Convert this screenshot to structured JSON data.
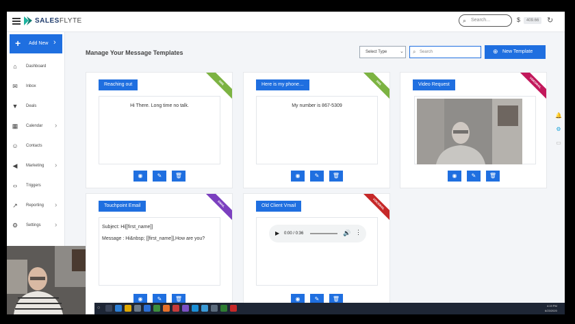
{
  "app": {
    "brand_part1": "SALES",
    "brand_part2": "FLYTE",
    "search_placeholder": "Search...",
    "currency": "$",
    "balance": "409.66"
  },
  "sidebar": {
    "add_new": "Add New",
    "items": [
      {
        "label": "Dashboard",
        "icon": "home-icon",
        "glyph": "⌂",
        "chevron": ""
      },
      {
        "label": "Inbox",
        "icon": "chat-icon",
        "glyph": "✉",
        "chevron": ""
      },
      {
        "label": "Deals",
        "icon": "filter-icon",
        "glyph": "▼",
        "chevron": ""
      },
      {
        "label": "Calendar",
        "icon": "calendar-icon",
        "glyph": "▦",
        "chevron": "›"
      },
      {
        "label": "Contacts",
        "icon": "users-icon",
        "glyph": "☺",
        "chevron": ""
      },
      {
        "label": "Marketing",
        "icon": "megaphone-icon",
        "glyph": "◀",
        "chevron": "›"
      },
      {
        "label": "Triggers",
        "icon": "code-icon",
        "glyph": "‹›",
        "chevron": ""
      },
      {
        "label": "Reporting",
        "icon": "chart-icon",
        "glyph": "↗",
        "chevron": "›"
      },
      {
        "label": "Settings",
        "icon": "gears-icon",
        "glyph": "⚙",
        "chevron": "›"
      }
    ]
  },
  "main": {
    "title": "Manage Your Message Templates",
    "select_type": "Select Type",
    "search_placeholder": "Search",
    "new_template": "New Template"
  },
  "templates": [
    {
      "title": "Reaching out",
      "type": "SMS",
      "ribbon_color": "#7cb342",
      "preview": "Hi There. Long time no talk."
    },
    {
      "title": "Here is my phone n...",
      "type": "SMS",
      "ribbon_color": "#7cb342",
      "preview": "My number is 867-5309"
    },
    {
      "title": "Video Request",
      "type": "VIDEOMAIL",
      "ribbon_color": "#c2185b",
      "preview": ""
    },
    {
      "title": "Touchpoint Email",
      "type": "EMAIL",
      "ribbon_color": "#7b3fbf",
      "subject": "Subject: Hi[[first_name]]",
      "message": "Message : Hi&nbsp; [[first_name]],How are you?"
    },
    {
      "title": "Old Client Vmail",
      "type": "VOICEMAIL",
      "ribbon_color": "#c62828",
      "audio_time": "0:00 / 0:36"
    }
  ],
  "taskbar": {
    "time": "4:19 PM",
    "date": "6/23/2020"
  }
}
